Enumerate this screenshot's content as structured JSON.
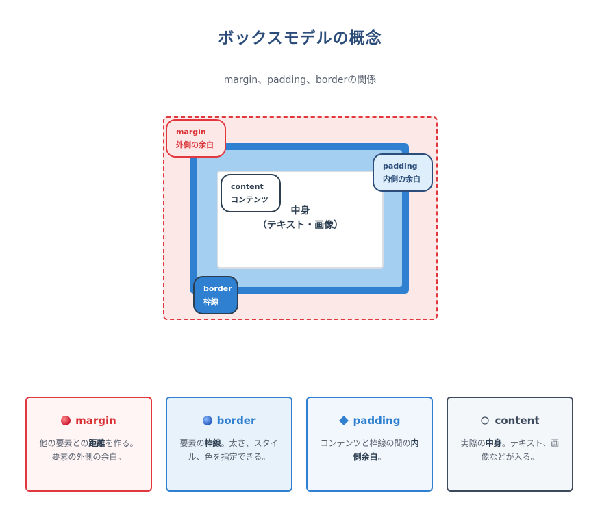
{
  "title": "ボックスモデルの概念",
  "subtitle": "margin、padding、borderの関係",
  "diagram": {
    "margin_tag": {
      "en": "margin",
      "ja": "外側の余白"
    },
    "padding_tag": {
      "en": "padding",
      "ja": "内側の余白"
    },
    "content_tag": {
      "en": "content",
      "ja": "コンテンツ"
    },
    "border_tag": {
      "en": "border",
      "ja": "枠線"
    },
    "center_line1": "中身",
    "center_line2": "（テキスト・画像）"
  },
  "cards": [
    {
      "icon": "red-circle-icon",
      "name": "margin",
      "desc_pre": "他の要素との",
      "desc_bold": "距離",
      "desc_post": "を作る。要素の外側の余白。"
    },
    {
      "icon": "blue-circle-icon",
      "name": "border",
      "desc_pre": "要素の",
      "desc_bold": "枠線",
      "desc_post": "。太さ、スタイル、色を指定できる。"
    },
    {
      "icon": "blue-diamond-icon",
      "name": "padding",
      "desc_pre": "コンテンツと枠線の間の",
      "desc_bold": "内側余白",
      "desc_post": "。"
    },
    {
      "icon": "white-circle-icon",
      "name": "content",
      "desc_pre": "実際の",
      "desc_bold": "中身",
      "desc_post": "。テキスト、画像などが入る。"
    }
  ],
  "colors": {
    "margin": "#e0383e",
    "border": "#2f80d1",
    "padding": "#a5cff0",
    "content": "#3c4a5c",
    "title": "#2c4d7a"
  }
}
